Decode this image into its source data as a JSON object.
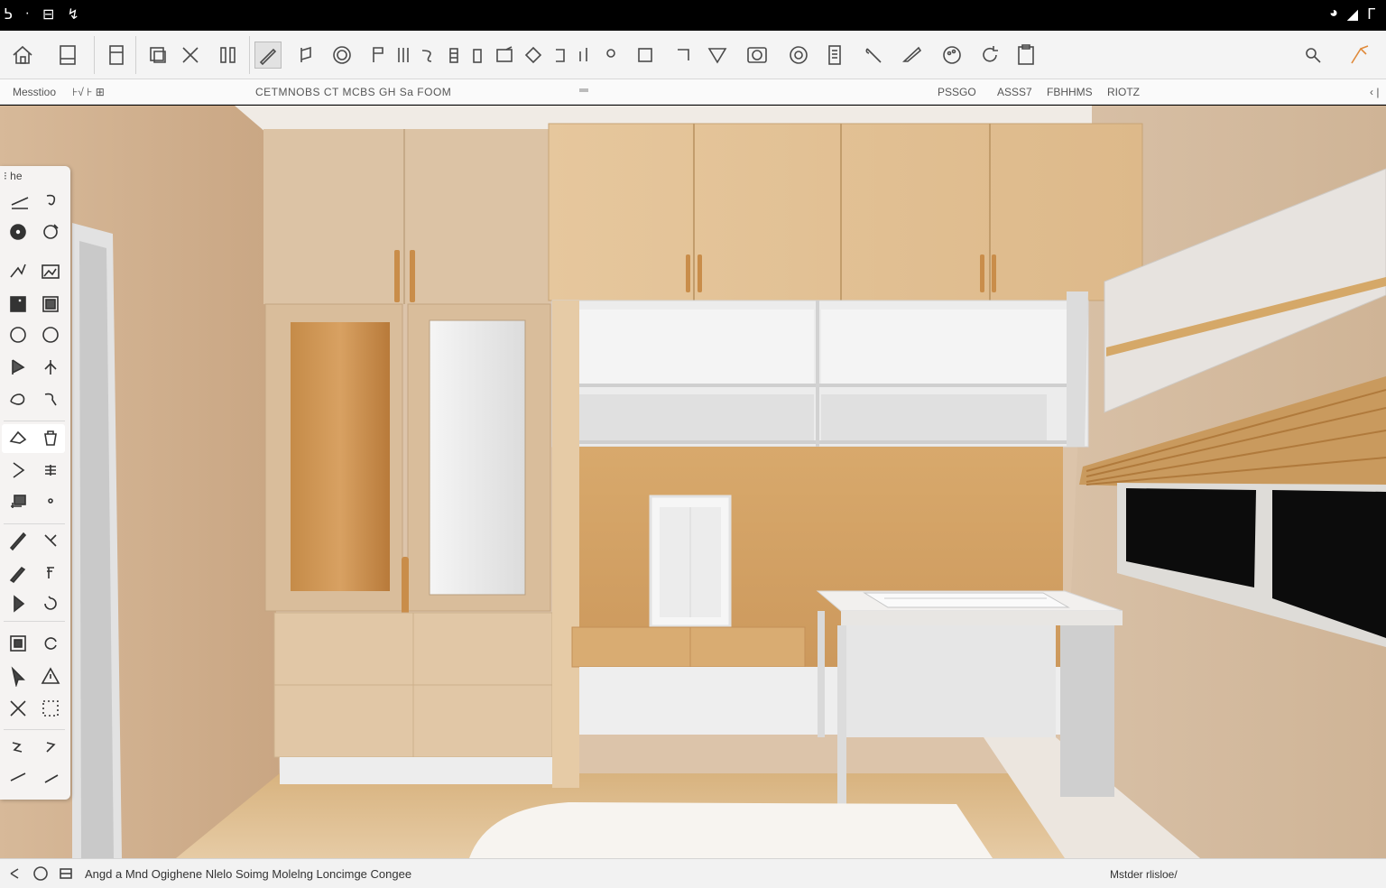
{
  "system_bar": {
    "left_glyphs": [
      "ᕊ",
      "·",
      "⊟",
      "↯"
    ],
    "right_glyphs": [
      "◕",
      "◢",
      "ᒥ"
    ]
  },
  "toolbar": {
    "tools": [
      "home-icon",
      "panel-icon",
      "cabinet-icon",
      "box-icon",
      "close-icon",
      "columns-icon",
      "pencil-icon",
      "push-pull-icon",
      "circle-icon",
      "flag-icon",
      "stack-icon",
      "arc-icon",
      "bars-icon",
      "bin-icon",
      "rect-icon",
      "diamond-icon",
      "bracket-icon",
      "line-icon",
      "dot-icon",
      "square-icon",
      "corner-icon",
      "triangle-icon",
      "camera-icon",
      "target-icon",
      "book-icon",
      "wrench-icon",
      "tape-icon",
      "palette-icon",
      "refresh-icon",
      "clipboard-icon",
      "search-icon",
      "orbit-icon"
    ]
  },
  "menubar": {
    "left_label": "Messtioo",
    "left_glyphs": "⊦√  ⊦ ⊞",
    "title": "CETMNOBS CT MCBS GH Sa FOOM",
    "right_items": [
      "PSSGO",
      "ASSS7",
      "FBHHMS",
      "RIOTZ"
    ],
    "corner_glyph": "‹ |"
  },
  "palette": {
    "title": "⁝ he",
    "tools": [
      "draw-line-icon",
      "lasso-icon",
      "eye-icon",
      "orbit-icon",
      "pen-icon",
      "image-icon",
      "layer-icon",
      "frame-icon",
      "circle-icon",
      "ellipse-icon",
      "flag-icon",
      "scale-icon",
      "shape-icon",
      "sketch-icon",
      "eraser-icon",
      "bucket-icon",
      "play-icon",
      "grid-icon",
      "section-icon",
      "point-icon",
      "paint-icon",
      "cut-icon",
      "brush-icon",
      "edit-icon",
      "arrow-icon",
      "rotate-icon",
      "group-icon",
      "loop-icon",
      "select-icon",
      "warning-icon",
      "cross-icon",
      "dots-icon",
      "wave-icon",
      "text-icon",
      "line-icon",
      "slash-icon"
    ]
  },
  "status": {
    "text": "Angd a Mnd  Oɡighene Nlelo Soimg Molelng Loncimge Congee",
    "right_text": "Mstder rlisloe/"
  },
  "colors": {
    "accent": "#e08a3a",
    "wall": "#d9bfa4",
    "wood_light": "#e3c49b",
    "wood_mid": "#cf9f63",
    "panel_white": "#ececec"
  }
}
